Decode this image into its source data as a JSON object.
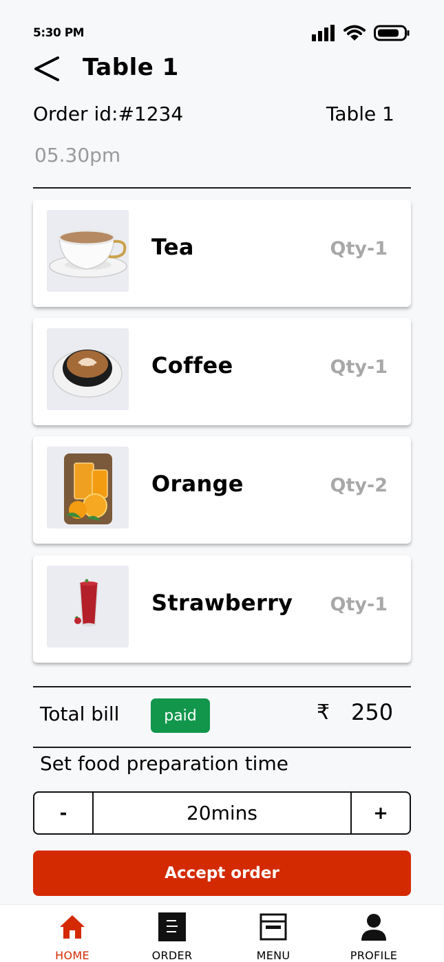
{
  "status_bar": {
    "time": "5:30 PM"
  },
  "header": {
    "title": "Table 1"
  },
  "order": {
    "id_label": "Order id:#1234",
    "table": "Table 1",
    "time": "05.30pm"
  },
  "items": [
    {
      "name": "Tea",
      "qty": "Qty-1",
      "image": "tea-cup"
    },
    {
      "name": "Coffee",
      "qty": "Qty-1",
      "image": "coffee-cup"
    },
    {
      "name": "Orange",
      "qty": "Qty-2",
      "image": "orange-juice"
    },
    {
      "name": "Strawberry",
      "qty": "Qty-1",
      "image": "strawberry-juice"
    }
  ],
  "bill": {
    "label": "Total bill",
    "status": "paid",
    "currency": "₹",
    "amount": "250"
  },
  "prep": {
    "label": "Set food preparation time",
    "minus": "-",
    "value": "20mins",
    "plus": "+"
  },
  "accept_button": "Accept order",
  "nav": [
    {
      "label": "HOME",
      "icon": "home-icon",
      "active": true
    },
    {
      "label": "ORDER",
      "icon": "order-icon",
      "active": false
    },
    {
      "label": "MENU",
      "icon": "menu-icon",
      "active": false
    },
    {
      "label": "PROFILE",
      "icon": "profile-icon",
      "active": false
    }
  ],
  "colors": {
    "accent": "#d42a02",
    "paid": "#12964c",
    "muted": "#a8a8a8",
    "background": "#f7f8fa"
  }
}
